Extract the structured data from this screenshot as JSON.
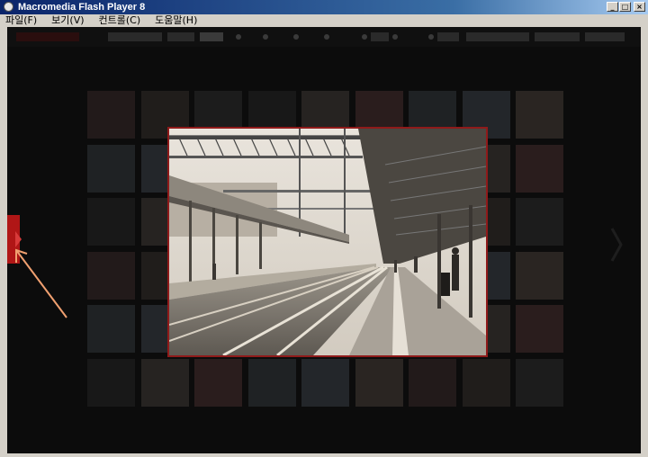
{
  "window": {
    "title": "Macromedia Flash Player 8",
    "buttons": {
      "minimize": "_",
      "maximize": "□",
      "close": "×"
    }
  },
  "menu": {
    "items": [
      "파일(F)",
      "보기(V)",
      "컨트롤(C)",
      "도움말(H)"
    ]
  },
  "colors": {
    "accent": "#b01616",
    "photo_frame": "#8f1a1a",
    "arrow": "#f0a070",
    "stage_bg": "#0c0c0c"
  },
  "icons": {
    "left_tab": "left-nav-tab-icon",
    "right_nav": "chevron-right-icon",
    "annotation": "annotation-arrow-icon"
  }
}
